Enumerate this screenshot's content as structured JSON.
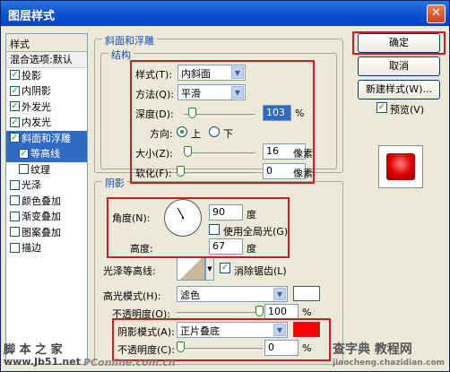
{
  "window": {
    "title": "图层样式",
    "close": "✕"
  },
  "stylelist": {
    "header": "样式",
    "blend": "混合选项:默认",
    "items": [
      {
        "label": "投影",
        "checked": true
      },
      {
        "label": "内阴影",
        "checked": true
      },
      {
        "label": "外发光",
        "checked": true
      },
      {
        "label": "内发光",
        "checked": true
      },
      {
        "label": "斜面和浮雕",
        "checked": true,
        "selected": true
      },
      {
        "label": "等高线",
        "checked": true,
        "sub": true,
        "selected": true
      },
      {
        "label": "纹理",
        "checked": false,
        "sub": true
      },
      {
        "label": "光泽",
        "checked": false
      },
      {
        "label": "颜色叠加",
        "checked": false
      },
      {
        "label": "渐变叠加",
        "checked": false
      },
      {
        "label": "图案叠加",
        "checked": false
      },
      {
        "label": "描边",
        "checked": false
      }
    ]
  },
  "bevel": {
    "section_title": "斜面和浮雕",
    "structure_title": "结构",
    "style_label": "样式(T):",
    "style_value": "内斜面",
    "method_label": "方法(Q):",
    "method_value": "平滑",
    "depth_label": "深度(D):",
    "depth_value": "103",
    "depth_unit": "%",
    "direction_label": "方向:",
    "dir_up": "上",
    "dir_down": "下",
    "size_label": "大小(Z):",
    "size_value": "16",
    "size_unit": "像素",
    "soften_label": "软化(F):",
    "soften_value": "0",
    "soften_unit": "像素"
  },
  "shading": {
    "title": "阴影",
    "angle_label": "角度(N):",
    "angle_value": "90",
    "angle_unit": "度",
    "global_light_label": "使用全局光(G)",
    "altitude_label": "高度:",
    "altitude_value": "67",
    "altitude_unit": "度",
    "gloss_label": "光泽等高线:",
    "antialias_label": "消除锯齿(L)",
    "highlight_mode_label": "高光模式(H):",
    "highlight_mode_value": "滤色",
    "highlight_color": "#ffffff",
    "hl_opacity_label": "不透明度(O):",
    "hl_opacity_value": "100",
    "hl_opacity_unit": "%",
    "shadow_mode_label": "阴影模式(A):",
    "shadow_mode_value": "正片叠底",
    "shadow_color": "#ff0000",
    "sh_opacity_label": "不透明度(C):",
    "sh_opacity_value": "0",
    "sh_opacity_unit": "%"
  },
  "buttons": {
    "ok": "确定",
    "cancel": "取消",
    "new_style": "新建样式(W)...",
    "preview": "预览(V)"
  },
  "watermarks": {
    "left_top": "脚 本 之 家",
    "left_bottom": "www.Jb51.net",
    "pconline": "PConline.com.cn",
    "right_top": "查字典 教程网",
    "right_bottom": "jiaocheng.chazidian.com"
  }
}
